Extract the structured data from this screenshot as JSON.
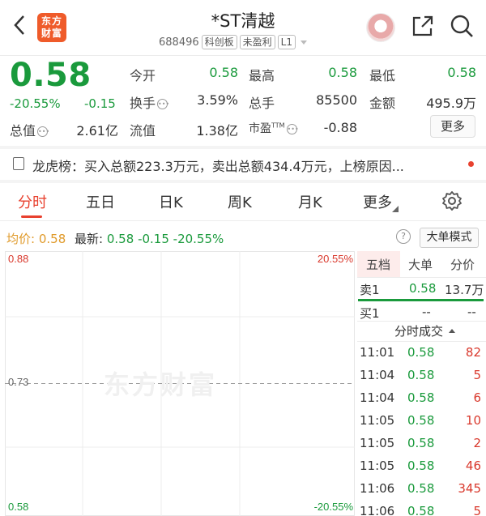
{
  "header": {
    "back_icon": "chevron-left-icon",
    "logo_text_line1": "东方",
    "logo_text_line2": "财富",
    "title": "*ST清越",
    "code": "688496",
    "tags": [
      "科创板",
      "未盈利",
      "L1"
    ],
    "share_icon": "share-icon",
    "search_icon": "search-icon"
  },
  "quote": {
    "price": "0.58",
    "change_pct": "-20.55%",
    "change": "-0.15",
    "fields": {
      "open_label": "今开",
      "open_value": "0.58",
      "high_label": "最高",
      "high_value": "0.58",
      "low_label": "最低",
      "low_value": "0.58",
      "turnover_rate_label": "换手",
      "turnover_rate_value": "3.59%",
      "volume_label": "总手",
      "volume_value": "85500",
      "amount_label": "金额",
      "amount_value": "495.9万",
      "total_cap_label": "总值",
      "total_cap_value": "2.61亿",
      "float_cap_label": "流值",
      "float_cap_value": "1.38亿",
      "pe_label": "市盈",
      "pe_sup": "TTM",
      "pe_value": "-0.88"
    },
    "more_button": "更多"
  },
  "dragon_tiger": {
    "text": "龙虎榜：买入总额223.3万元，卖出总额434.4万元，上榜原因..."
  },
  "tabs": {
    "items": [
      "分时",
      "五日",
      "日K",
      "周K",
      "月K",
      "更多"
    ],
    "active": "分时",
    "settings_icon": "gear-icon"
  },
  "avg_row": {
    "avg_label": "均价:",
    "avg_value": "0.58",
    "latest_label": "最新:",
    "latest_value": "0.58",
    "latest_change": "-0.15",
    "latest_pct": "-20.55%",
    "help_icon": "question-icon",
    "big_order_button": "大单模式"
  },
  "chart_data": {
    "type": "line",
    "title": "",
    "y_labels_left": [
      "0.88",
      "0.73",
      "0.58"
    ],
    "y_labels_right": [
      "20.55%",
      "-20.55%"
    ],
    "ylim": [
      0.58,
      0.88
    ],
    "reference_price": 0.73,
    "watermark": "东方财富",
    "series": []
  },
  "order_book": {
    "tabs": [
      "五档",
      "大单",
      "分价"
    ],
    "active_tab": "五档",
    "sell": [
      {
        "label": "卖1",
        "price": "0.58",
        "volume": "13.7万"
      }
    ],
    "buy": [
      {
        "label": "买1",
        "price": "--",
        "volume": "--"
      }
    ]
  },
  "trades": {
    "title": "分时成交",
    "rows": [
      {
        "time": "11:01",
        "price": "0.58",
        "volume": "82",
        "color": "#d9382c"
      },
      {
        "time": "11:04",
        "price": "0.58",
        "volume": "5",
        "color": "#d9382c"
      },
      {
        "time": "11:04",
        "price": "0.58",
        "volume": "6",
        "color": "#d9382c"
      },
      {
        "time": "11:05",
        "price": "0.58",
        "volume": "10",
        "color": "#d9382c"
      },
      {
        "time": "11:05",
        "price": "0.58",
        "volume": "2",
        "color": "#d9382c"
      },
      {
        "time": "11:05",
        "price": "0.58",
        "volume": "46",
        "color": "#d9382c"
      },
      {
        "time": "11:06",
        "price": "0.58",
        "volume": "345",
        "color": "#d9382c"
      },
      {
        "time": "11:06",
        "price": "0.58",
        "volume": "5",
        "color": "#d9382c"
      }
    ]
  },
  "colors": {
    "up": "#d9382c",
    "down": "#1a9a3c",
    "accent": "#e8412f"
  }
}
